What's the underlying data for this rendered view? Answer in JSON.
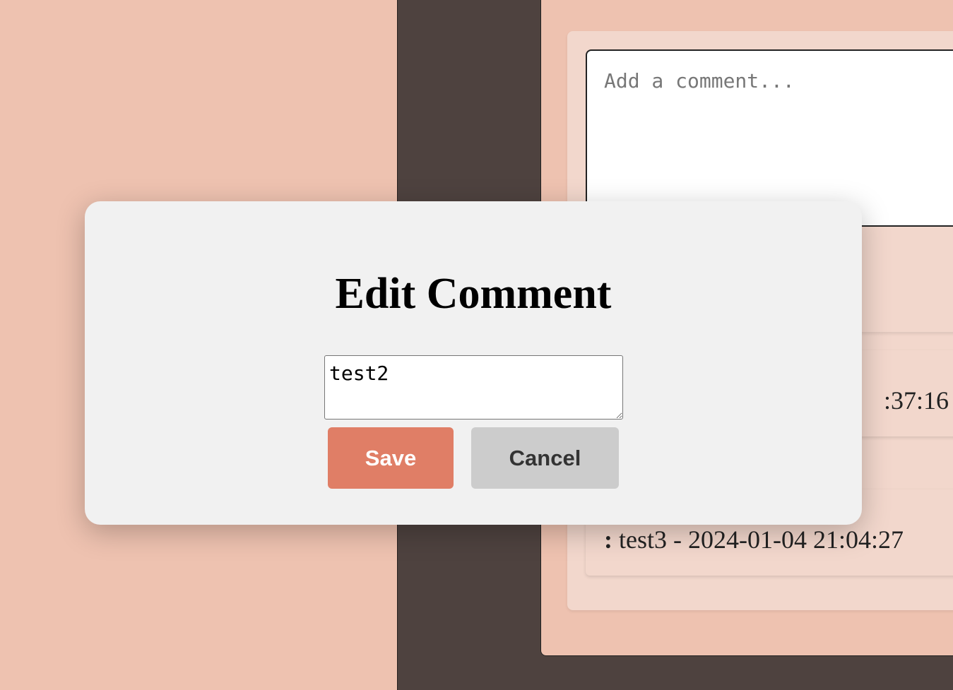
{
  "comment_form": {
    "placeholder": "Add a comment..."
  },
  "comments": [
    {
      "visible_text": ":37:16",
      "edit_icon": "pencil-icon"
    },
    {
      "prefix": ":",
      "text": " test3 - 2024-01-04 21:04:27",
      "edit_icon": "pencil-icon"
    }
  ],
  "modal": {
    "title": "Edit Comment",
    "textarea_value": "test2",
    "save_label": "Save",
    "cancel_label": "Cancel"
  },
  "colors": {
    "page_background": "#EEC2B0",
    "dark_column": "#4E423F",
    "card_background": "#F2D7CC",
    "modal_background": "#F1F1F1",
    "save_button": "#E07E66",
    "cancel_button": "#CCCCCC",
    "edit_icon": "#6B5FA8"
  }
}
